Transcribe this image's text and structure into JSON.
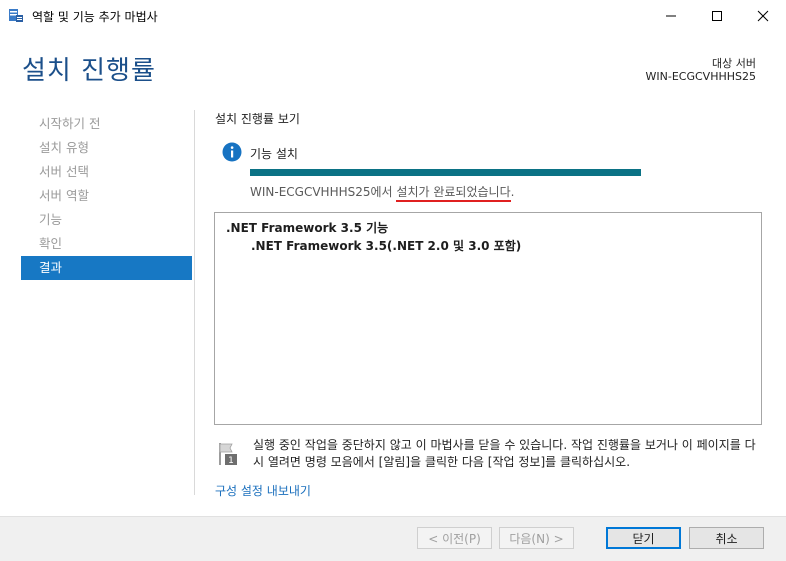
{
  "window": {
    "title": "역할 및 기능 추가 마법사"
  },
  "header": {
    "page_title": "설치 진행률",
    "target_label": "대상 서버",
    "target_value": "WIN-ECGCVHHHS25"
  },
  "sidebar": {
    "items": [
      {
        "label": "시작하기 전"
      },
      {
        "label": "설치 유형"
      },
      {
        "label": "서버 선택"
      },
      {
        "label": "서버 역할"
      },
      {
        "label": "기능"
      },
      {
        "label": "확인"
      },
      {
        "label": "결과"
      }
    ],
    "active_index": 6
  },
  "main": {
    "section_title": "설치 진행률 보기",
    "feature_label": "기능 설치",
    "progress": 1.0,
    "status_prefix": "WIN-ECGCVHHHS25에서 ",
    "status_emphasis": "설치가 완료되었습니다",
    "status_suffix": ".",
    "results": {
      "feature": ".NET Framework 3.5 기능",
      "sub_feature": ".NET Framework 3.5(.NET 2.0 및 3.0 포함)"
    },
    "note": "실행 중인 작업을 중단하지 않고 이 마법사를 닫을 수 있습니다. 작업 진행률을 보거나 이 페이지를 다시 열려면 명령 모음에서 [알림]을 클릭한 다음 [작업 정보]를 클릭하십시오.",
    "note_badge": "1",
    "export_link": "구성 설정 내보내기"
  },
  "footer": {
    "prev_label": "< 이전(P)",
    "next_label": "다음(N) >",
    "close_label": "닫기",
    "cancel_label": "취소"
  },
  "colors": {
    "accent": "#1778c4",
    "title": "#1b4f8a",
    "progress": "#0b7285",
    "underline": "#e02020",
    "link": "#1a6fbd"
  }
}
